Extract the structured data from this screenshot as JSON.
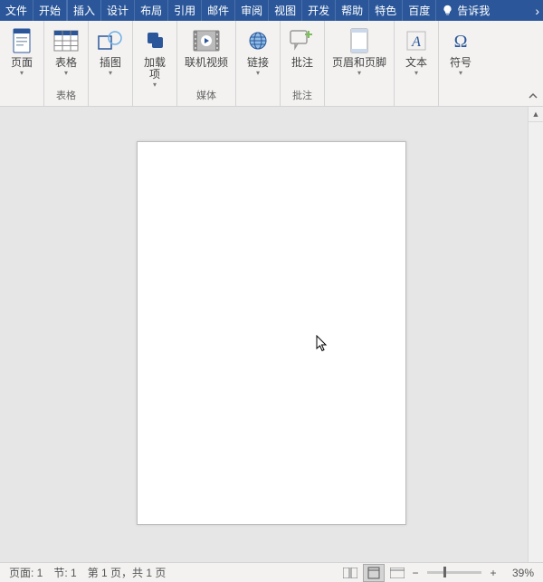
{
  "accent": "#2b579a",
  "tabs": {
    "file": "文件",
    "home": "开始",
    "insert": "插入",
    "design": "设计",
    "layout": "布局",
    "references": "引用",
    "mailings": "邮件",
    "review": "审阅",
    "view": "视图",
    "developer": "开发",
    "help": "帮助",
    "special": "特色",
    "baidu": "百度",
    "tellme": "告诉我"
  },
  "ribbon": {
    "groups": {
      "pages": {
        "button": "页面",
        "label": ""
      },
      "tables": {
        "button": "表格",
        "label": "表格"
      },
      "illustrations": {
        "button": "插图",
        "label": ""
      },
      "addins": {
        "button": "加载\n项",
        "label": ""
      },
      "media": {
        "button": "联机视频",
        "label": "媒体"
      },
      "links": {
        "button": "链接",
        "label": ""
      },
      "comments": {
        "button": "批注",
        "label": "批注"
      },
      "headerfooter": {
        "button": "页眉和页脚",
        "label": ""
      },
      "text": {
        "button": "文本",
        "label": ""
      },
      "symbols": {
        "button": "符号",
        "label": ""
      }
    }
  },
  "statusbar": {
    "page_label": "页面: 1",
    "section_label": "节: 1",
    "page_count": "第 1 页，共 1 页",
    "zoom": "39%"
  }
}
